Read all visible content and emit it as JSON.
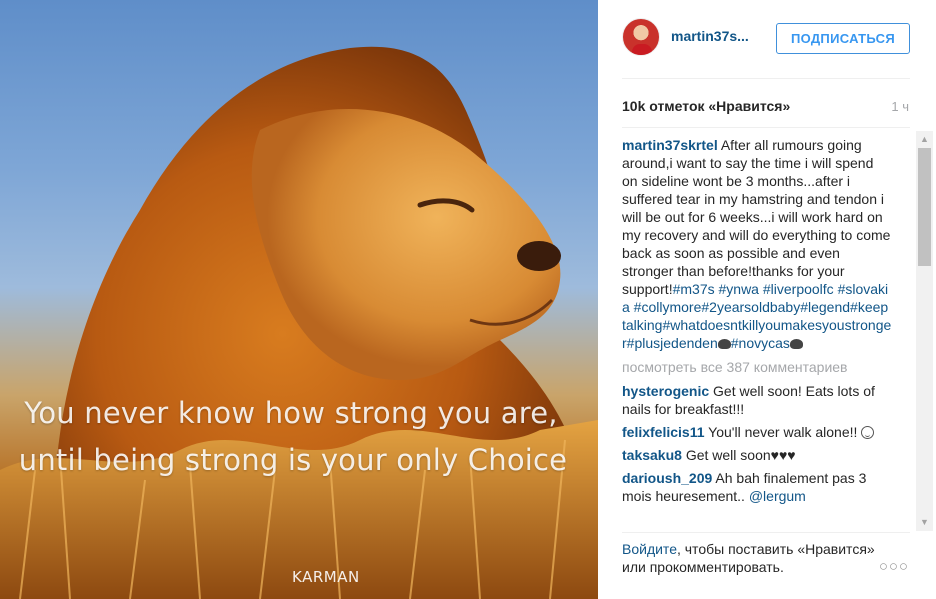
{
  "photo": {
    "quote_line_1": "You never know how strong you are,",
    "quote_line_2": "until being strong is your only Choice",
    "watermark": "KARMAN"
  },
  "header": {
    "username": "martin37s...",
    "follow_label": "ПОДПИСАТЬСЯ"
  },
  "stats": {
    "likes": "10k отметок «Нравится»",
    "time": "1 ч"
  },
  "caption": {
    "user": "martin37skrtel",
    "text": "After all rumours going around,i want to say the time i will spend on sideline wont be 3 months...after i suffered tear in my hamstring and tendon i will be out for 6 weeks...i will work hard on my recovery and will do everything to come back as soon as possible and even stronger than before!thanks for your support!",
    "tags_1": "#m37s #ynwa #liverpoolfc #slovakia #collymore#2yearsoldbaby#legend#keeptalking#whatdoesntkillyoumakesyoustronger#plusjedenden",
    "tags_2": "#novycas"
  },
  "view_all_comments": "посмотреть все 387 комментариев",
  "comments": [
    {
      "user": "hysterogenic",
      "text": "Get well soon! Eats lots of nails for breakfast!!!"
    },
    {
      "user": "felixfelicis11",
      "text": "You'll never walk alone!!"
    },
    {
      "user": "taksaku8",
      "text": "Get well soon♥♥♥"
    },
    {
      "user": "darioush_209",
      "text": "Ah bah finalement pas 3 mois heuresement.. ",
      "mention": "@lergum"
    }
  ],
  "footer": {
    "login_link": "Войдите",
    "rest": ", чтобы поставить «Нравится» или прокомментировать.",
    "more_label": "○○○"
  },
  "icons": {
    "scroll_up": "▲",
    "scroll_down": "▼"
  },
  "colors": {
    "link": "#125688",
    "follow": "#3897f0",
    "muted": "#a5a7aa"
  }
}
